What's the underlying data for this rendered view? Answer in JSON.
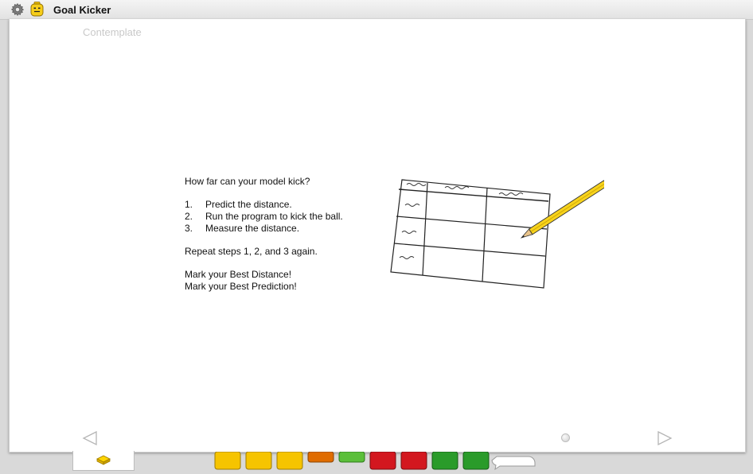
{
  "window": {
    "title": "Goal Kicker",
    "icons": [
      "gear-icon",
      "minifigure-icon"
    ]
  },
  "panel": {
    "label": "Contemplate",
    "question": "How far can your model kick?",
    "steps": [
      {
        "num": "1.",
        "text": "Predict the distance."
      },
      {
        "num": "2.",
        "text": "Run the program to kick the ball."
      },
      {
        "num": "3.",
        "text": "Measure the distance."
      }
    ],
    "repeat": "Repeat steps 1, 2, and 3 again.",
    "marks": [
      "Mark your Best Distance!",
      "Mark your Best Prediction!"
    ],
    "illustration": "table-with-pencil-icon"
  },
  "navigation": {
    "prev_icon": "triangle-left-icon",
    "next_icon": "triangle-right-icon",
    "page_indicator_icon": "page-dot-icon"
  },
  "bottom_tab": {
    "icon": "lego-brick-icon"
  },
  "colors": {
    "accent_yellow": "#f2c200",
    "lego_red": "#d3171f",
    "lego_green": "#2a9b2a",
    "lego_orange": "#e06c00"
  }
}
